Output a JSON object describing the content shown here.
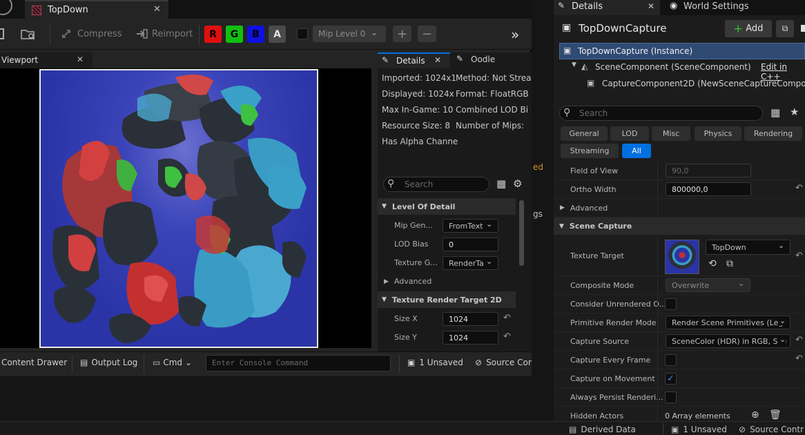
{
  "tex_editor": {
    "tab_title": "TopDown",
    "toolbar": {
      "compress": "Compress",
      "reimport": "Reimport",
      "channels": [
        "R",
        "G",
        "B",
        "A"
      ],
      "mip_level": "Mip Level 0"
    },
    "viewport_tab": "Viewport",
    "details_tabs": [
      "Details",
      "Oodle"
    ],
    "info": {
      "imported": "Imported: 1024x1",
      "method": "Method: Not Strea",
      "displayed": "Displayed: 1024x",
      "format": "Format: FloatRGB",
      "max_in_game": "Max In-Game: 10",
      "combined_lod": "Combined LOD Bi",
      "resource_size": "Resource Size: 8",
      "num_mips": "Number of Mips: ",
      "has_alpha": "Has Alpha Channe"
    },
    "search_placeholder": "Search",
    "lod_category": "Level Of Detail",
    "mip_gen_label": "Mip Gen...",
    "mip_gen_value": "FromText",
    "lod_bias_label": "LOD Bias",
    "lod_bias_value": "0",
    "texture_group_label": "Texture G...",
    "texture_group_value": "RenderTa",
    "advanced": "Advanced",
    "rt2d_category": "Texture Render Target 2D",
    "size_x_label": "Size X",
    "size_x_value": "1024",
    "size_y_label": "Size Y",
    "size_y_value": "1024"
  },
  "bottom_bar": {
    "content_drawer": "Content Drawer",
    "output_log": "Output Log",
    "cmd": "Cmd",
    "console_placeholder": "Enter Console Command",
    "unsaved": "1 Unsaved",
    "source_control": "Source Cor"
  },
  "bg_editor": {
    "partial_ed": "ed",
    "partial_gs": "gs"
  },
  "right_panel": {
    "tabs": [
      "Details",
      "World Settings"
    ],
    "actor_name": "TopDownCapture",
    "add_button": "Add",
    "tree": {
      "instance": "TopDownCapture (Instance)",
      "scene_component": "SceneComponent (SceneComponent)",
      "edit_cpp": "Edit in C++",
      "capture_component": "CaptureComponent2D (NewSceneCaptureComponent"
    },
    "search_placeholder": "Search",
    "filters": [
      "General",
      "LOD",
      "Misc",
      "Physics",
      "Rendering",
      "Streaming",
      "All"
    ],
    "active_filter": "All",
    "props": {
      "fov_label": "Field of View",
      "fov_value": "90,0",
      "ortho_label": "Ortho Width",
      "ortho_value": "800000,0",
      "advanced": "Advanced",
      "scene_capture": "Scene Capture",
      "texture_target_label": "Texture Target",
      "texture_target_value": "TopDown",
      "composite_label": "Composite Mode",
      "composite_value": "Overwrite",
      "consider_label": "Consider Unrendered O...",
      "primitive_label": "Primitive Render Mode",
      "primitive_value": "Render Scene Primitives (Leg",
      "capture_source_label": "Capture Source",
      "capture_source_value": "SceneColor (HDR) in RGB, Sce",
      "every_frame_label": "Capture Every Frame",
      "on_movement_label": "Capture on Movement",
      "on_movement_checked": true,
      "persist_label": "Always Persist Renderi...",
      "hidden_actors_label": "Hidden Actors",
      "hidden_actors_value": "0 Array elements"
    }
  },
  "status_bar": {
    "derived_data": "Derived Data",
    "unsaved": "1 Unsaved",
    "source_control": "Source Contr"
  },
  "colors": {
    "accent": "#0070e0",
    "selection": "#2f4a73",
    "texture_bg": "#2a34a6"
  }
}
